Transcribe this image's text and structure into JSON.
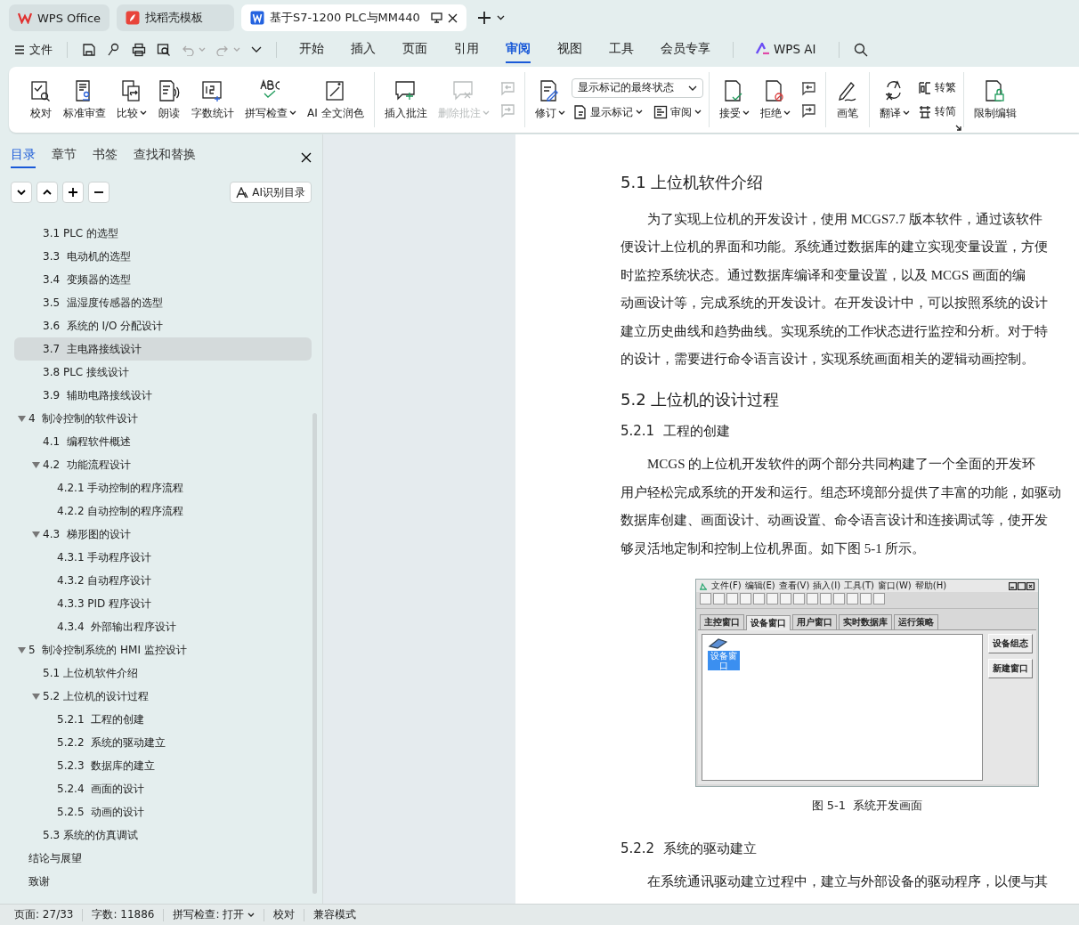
{
  "title_tabs": [
    {
      "label": "WPS Office",
      "kind": "home",
      "selected": false
    },
    {
      "label": "找稻壳模板",
      "kind": "template",
      "selected": false
    },
    {
      "label": "基于S7-1200 PLC与MM440",
      "kind": "document",
      "selected": true
    }
  ],
  "quick_access": {
    "file_menu": "文件"
  },
  "menu_tabs": [
    {
      "label": "开始",
      "selected": false
    },
    {
      "label": "插入",
      "selected": false
    },
    {
      "label": "页面",
      "selected": false
    },
    {
      "label": "引用",
      "selected": false
    },
    {
      "label": "审阅",
      "selected": true
    },
    {
      "label": "视图",
      "selected": false
    },
    {
      "label": "工具",
      "selected": false
    },
    {
      "label": "会员专享",
      "selected": false
    },
    {
      "label": "WPS AI",
      "selected": false,
      "kind": "ai"
    }
  ],
  "ribbon": {
    "groups": [
      {
        "items": [
          {
            "kind": "large",
            "label": "校对",
            "dropdown": false,
            "disabled": false
          },
          {
            "kind": "large",
            "label": "标准审查",
            "dropdown": false,
            "disabled": false
          },
          {
            "kind": "large",
            "label": "比较",
            "dropdown": true,
            "disabled": false
          },
          {
            "kind": "large",
            "label": "朗读",
            "dropdown": false,
            "disabled": false
          },
          {
            "kind": "large",
            "label": "字数统计",
            "dropdown": false,
            "disabled": false
          },
          {
            "kind": "large",
            "label": "拼写检查",
            "dropdown": true,
            "disabled": false
          },
          {
            "kind": "large",
            "label": "AI 全文润色",
            "dropdown": false,
            "disabled": false
          }
        ]
      },
      {
        "items": [
          {
            "kind": "large",
            "label": "插入批注",
            "dropdown": false,
            "disabled": false
          },
          {
            "kind": "large",
            "label": "删除批注",
            "dropdown": true,
            "disabled": true
          },
          {
            "kind": "stack",
            "rows": [
              [
                {
                  "kind": "icon",
                  "disabled": true
                }
              ],
              [
                {
                  "kind": "icon",
                  "disabled": true
                }
              ]
            ]
          }
        ]
      },
      {
        "items": [
          {
            "kind": "large",
            "label": "修订",
            "dropdown": true,
            "disabled": false
          },
          {
            "kind": "stack",
            "rows": [
              [
                {
                  "kind": "select",
                  "value": "显示标记的最终状态"
                }
              ],
              [
                {
                  "kind": "small",
                  "label": "显示标记",
                  "dropdown": true,
                  "disabled": false
                },
                {
                  "kind": "small",
                  "label": "审阅",
                  "dropdown": true,
                  "disabled": false
                }
              ]
            ]
          }
        ]
      },
      {
        "items": [
          {
            "kind": "large",
            "label": "接受",
            "dropdown": true,
            "disabled": false
          },
          {
            "kind": "large",
            "label": "拒绝",
            "dropdown": true,
            "disabled": false
          },
          {
            "kind": "stack",
            "rows": [
              [
                {
                  "kind": "icon",
                  "disabled": false
                }
              ],
              [
                {
                  "kind": "icon",
                  "disabled": false
                }
              ]
            ]
          }
        ]
      },
      {
        "items": [
          {
            "kind": "large",
            "label": "画笔",
            "dropdown": false,
            "disabled": false
          }
        ]
      },
      {
        "items": [
          {
            "kind": "large",
            "label": "翻译",
            "dropdown": true,
            "disabled": false
          },
          {
            "kind": "stack",
            "rows": [
              [
                {
                  "kind": "small",
                  "label": "转繁",
                  "dropdown": false,
                  "disabled": false
                }
              ],
              [
                {
                  "kind": "small",
                  "label": "转简",
                  "dropdown": false,
                  "disabled": false
                }
              ]
            ]
          }
        ]
      },
      {
        "items": [
          {
            "kind": "large",
            "label": "限制编辑",
            "dropdown": false,
            "disabled": false
          }
        ]
      }
    ]
  },
  "sidebar": {
    "tabs": [
      {
        "label": "目录",
        "selected": true
      },
      {
        "label": "章节",
        "selected": false
      },
      {
        "label": "书签",
        "selected": false
      },
      {
        "label": "查找和替换",
        "selected": false
      }
    ],
    "ai_button": "AI识别目录",
    "toc_continued": [
      {
        "label": "3.1 PLC 的选型",
        "selected": false
      },
      {
        "label": "3.3  电动机的选型",
        "selected": false
      },
      {
        "label": "3.4  变频器的选型",
        "selected": false
      },
      {
        "label": "3.5  温湿度传感器的选型",
        "selected": false
      },
      {
        "label": "3.6  系统的 I/O 分配设计",
        "selected": false
      },
      {
        "label": "3.7  主电路接线设计",
        "selected": true
      },
      {
        "label": "3.8 PLC 接线设计",
        "selected": false
      },
      {
        "label": "3.9  辅助电路接线设计",
        "selected": false
      }
    ],
    "toc": [
      {
        "label": "4  制冷控制的软件设计",
        "selected": false,
        "expanded": true,
        "children": [
          {
            "label": "4.1  编程软件概述",
            "selected": false
          },
          {
            "label": "4.2  功能流程设计",
            "selected": false,
            "expanded": true,
            "children": [
              {
                "label": "4.2.1 手动控制的程序流程",
                "selected": false
              },
              {
                "label": "4.2.2 自动控制的程序流程",
                "selected": false
              }
            ]
          },
          {
            "label": "4.3  梯形图的设计",
            "selected": false,
            "expanded": true,
            "children": [
              {
                "label": "4.3.1 手动程序设计",
                "selected": false
              },
              {
                "label": "4.3.2 自动程序设计",
                "selected": false
              },
              {
                "label": "4.3.3 PID 程序设计",
                "selected": false
              },
              {
                "label": "4.3.4  外部输出程序设计",
                "selected": false
              }
            ]
          }
        ]
      },
      {
        "label": "5  制冷控制系统的 HMI 监控设计",
        "selected": false,
        "expanded": true,
        "children": [
          {
            "label": "5.1 上位机软件介绍",
            "selected": false
          },
          {
            "label": "5.2 上位机的设计过程",
            "selected": false,
            "expanded": true,
            "children": [
              {
                "label": "5.2.1  工程的创建",
                "selected": false
              },
              {
                "label": "5.2.2  系统的驱动建立",
                "selected": false
              },
              {
                "label": "5.2.3  数据库的建立",
                "selected": false
              },
              {
                "label": "5.2.4  画面的设计",
                "selected": false
              },
              {
                "label": "5.2.5  动画的设计",
                "selected": false
              }
            ]
          },
          {
            "label": "5.3 系统的仿真调试",
            "selected": false
          }
        ]
      },
      {
        "label": "结论与展望",
        "selected": false
      },
      {
        "label": "致谢",
        "selected": false
      }
    ]
  },
  "document": {
    "blocks": [
      {
        "kind": "heading",
        "text": "5.1 上位机软件介绍"
      },
      {
        "kind": "paragraph",
        "lines": [
          "为了实现上位机的开发设计，使用 MCGS7.7 版本软件，通过该软件",
          "便设计上位机的界面和功能。系统通过数据库的建立实现变量设置，方便",
          "时监控系统状态。通过数据库编译和变量设置，以及 MCGS 画面的编",
          "动画设计等，完成系统的开发设计。在开发设计中，可以按照系统的设计",
          "建立历史曲线和趋势曲线。实现系统的工作状态进行监控和分析。对于特",
          "的设计，需要进行命令语言设计，实现系统画面相关的逻辑动画控制。"
        ]
      },
      {
        "kind": "heading",
        "text": "5.2 上位机的设计过程"
      },
      {
        "kind": "subheading",
        "text": "5.2.1  工程的创建"
      },
      {
        "kind": "paragraph",
        "lines": [
          "MCGS 的上位机开发软件的两个部分共同构建了一个全面的开发环",
          "用户轻松完成系统的开发和运行。组态环境部分提供了丰富的功能，如驱动",
          "数据库创建、画面设计、动画设置、命令语言设计和连接调试等，使开发",
          "够灵活地定制和控制上位机界面。如下图 5-1 所示。"
        ]
      },
      {
        "kind": "figure",
        "window": {
          "menu": [
            "文件(F)",
            "编辑(E)",
            "查看(V)",
            "插入(I)",
            "工具(T)",
            "窗口(W)",
            "帮助(H)"
          ],
          "tabs": [
            {
              "label": "主控窗口",
              "selected": false
            },
            {
              "label": "设备窗口",
              "selected": true
            },
            {
              "label": "用户窗口",
              "selected": false
            },
            {
              "label": "实时数据库",
              "selected": false
            },
            {
              "label": "运行策略",
              "selected": false
            }
          ],
          "item_label": "设备窗口",
          "side_buttons": [
            "设备组态",
            "新建窗口"
          ]
        },
        "caption": "图 5-1  系统开发画面"
      },
      {
        "kind": "subheading",
        "text": "5.2.2  系统的驱动建立"
      },
      {
        "kind": "paragraph",
        "lines": [
          "在系统通讯驱动建立过程中，建立与外部设备的驱动程序，以便与其"
        ]
      }
    ]
  },
  "status_bar": [
    {
      "kind": "text",
      "label": "页面: 27/33"
    },
    {
      "kind": "text",
      "label": "字数: 11886"
    },
    {
      "kind": "dropdown",
      "label": "拼写检查: 打开"
    },
    {
      "kind": "button",
      "label": "校对"
    },
    {
      "kind": "text",
      "label": "兼容模式"
    }
  ]
}
